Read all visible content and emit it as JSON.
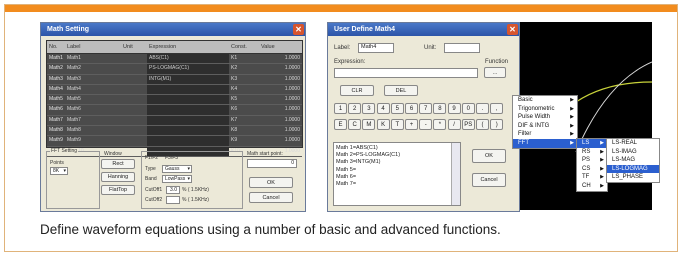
{
  "math_setting": {
    "title": "Math Setting",
    "columns": [
      "No.",
      "Label",
      "Unit",
      "Expression",
      "Const.",
      "Value"
    ],
    "rows": [
      {
        "no": "Math1",
        "label": "Math1",
        "expr": "ABS(C1)",
        "const": "K1",
        "value": "1.0000"
      },
      {
        "no": "Math2",
        "label": "Math2",
        "expr": "PS-LOGMAG(C1)",
        "const": "K2",
        "value": "1.0000"
      },
      {
        "no": "Math3",
        "label": "Math3",
        "expr": "INTG(M1)",
        "const": "K3",
        "value": "1.0000"
      },
      {
        "no": "Math4",
        "label": "Math4",
        "expr": "",
        "const": "K4",
        "value": "1.0000"
      },
      {
        "no": "Math5",
        "label": "Math5",
        "expr": "",
        "const": "K5",
        "value": "1.0000"
      },
      {
        "no": "Math6",
        "label": "Math6",
        "expr": "",
        "const": "K6",
        "value": "1.0000"
      },
      {
        "no": "Math7",
        "label": "Math7",
        "expr": "",
        "const": "K7",
        "value": "1.0000"
      },
      {
        "no": "Math8",
        "label": "Math8",
        "expr": "",
        "const": "K8",
        "value": "1.0000"
      },
      {
        "no": "Math9",
        "label": "Math9",
        "expr": "",
        "const": "K9",
        "value": "1.0000"
      },
      {
        "no": "Math10",
        "label": "Math10",
        "expr": "",
        "const": "K10",
        "value": "1.0000"
      }
    ],
    "fft_setting": "FFT Setting",
    "points_label": "Points",
    "points_value": "8K",
    "window_label": "Window",
    "window_buttons": [
      "Rect",
      "Hanning",
      "FlatTop"
    ],
    "tabs": [
      "F1/F2",
      "F3/F3"
    ],
    "type_label": "Type",
    "type_value": "Gauss",
    "band_label": "Band",
    "band_value": "LowPass",
    "cutoff1_label": "CutOff1",
    "cutoff1_value": "3.0",
    "cutoff2_label": "CutOff2",
    "cutoff2_value": "",
    "cutoff_unit": "% ( 1.5KHz)",
    "start_label": "Math start point:",
    "start_value": "0",
    "ok": "OK",
    "cancel": "Cancel"
  },
  "user_define": {
    "title": "User Define Math4",
    "label_label": "Label:",
    "label_value": "Math4",
    "unit_label": "Unit:",
    "unit_value": "",
    "expression_label": "Expression:",
    "function_label": "Function",
    "function_btn": "...",
    "clr": "CLR",
    "del": "DEL",
    "keys_row1": [
      "1",
      "2",
      "3",
      "4",
      "5",
      "6",
      "7",
      "8",
      "9",
      "0",
      ".",
      ","
    ],
    "keys_row2": [
      "E",
      "C",
      "M",
      "K",
      "T",
      "+",
      "-",
      "*",
      "/",
      "PS",
      "(",
      ")"
    ],
    "list": [
      "Math 1=ABS(C1)",
      "Math 2=PS-LOGMAG(C1)",
      "Math 3=INTG(M1)",
      "Math 5=",
      "Math 6=",
      "Math 7="
    ],
    "ok": "OK",
    "cancel": "Cancel"
  },
  "function_menu": {
    "items": [
      "Basic",
      "Trigonometric",
      "Pulse Width",
      "DIF & INTG",
      "Filter",
      "FFT"
    ],
    "highlight": "FFT"
  },
  "fft_submenu": {
    "items": [
      "LS",
      "RS",
      "PS",
      "CS",
      "TF",
      "CH"
    ],
    "highlight": "LS"
  },
  "ls_submenu": {
    "items": [
      "LS-REAL",
      "LS-IMAG",
      "LS-MAG",
      "LS-LOGMAG",
      "LS_PHASE"
    ],
    "highlight": "LS-LOGMAG"
  },
  "caption": "Define waveform equations using a number of basic and advanced functions.",
  "colors": {
    "accent": "#f28c1e",
    "title_bar": "#2c54a8",
    "highlight": "#2b5fcf"
  }
}
